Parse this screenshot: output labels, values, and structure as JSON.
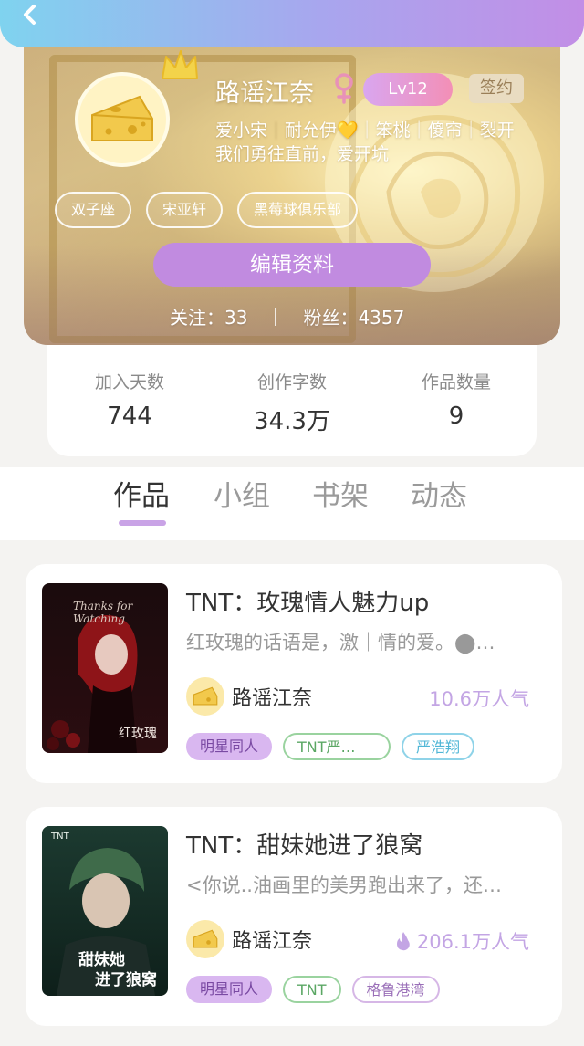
{
  "profile": {
    "name": "路谣江奈",
    "level": "Lv12",
    "signed": "签约",
    "intro_line1": "爱小宋｜耐允伊💛｜笨桃｜傻帘｜裂开",
    "intro_line2": "我们勇往直前，爱开坑",
    "tags": [
      "双子座",
      "宋亚轩",
      "黑莓球俱乐部"
    ],
    "edit_button": "编辑资料",
    "following_label": "关注：",
    "following_count": "33",
    "fans_label": "粉丝：",
    "fans_count": "4357"
  },
  "stats": [
    {
      "label": "加入天数",
      "value": "744"
    },
    {
      "label": "创作字数",
      "value": "34.3万"
    },
    {
      "label": "作品数量",
      "value": "9"
    }
  ],
  "tabs": [
    {
      "label": "作品",
      "active": true
    },
    {
      "label": "小组",
      "active": false
    },
    {
      "label": "书架",
      "active": false
    },
    {
      "label": "动态",
      "active": false
    }
  ],
  "works": [
    {
      "title": "TNT：玫瑰情人魅力up",
      "desc": "红玫瑰的话语是，激｜情的爱。⬤…",
      "author": "路谣江奈",
      "popularity": "10.6万人气",
      "cover_text": "红玫瑰",
      "cover_script": "Thanks for Watching",
      "tags": [
        "明星同人",
        "TNT严…",
        "严浩翔"
      ]
    },
    {
      "title": "TNT：甜妹她进了狼窝",
      "desc": "<你说..油画里的美男跑出来了，还…",
      "author": "路谣江奈",
      "popularity": "206.1万人气",
      "cover_text_1": "甜妹她",
      "cover_text_2": "进了狼窝",
      "cover_brand": "TNT",
      "tags": [
        "明星同人",
        "TNT",
        "格鲁港湾"
      ]
    }
  ],
  "colors": {
    "accent_purple": "#c18be0",
    "popularity": "#c3a5e4",
    "header_gradient_start": "#7fd3ef",
    "header_gradient_end": "#c28ee6"
  }
}
